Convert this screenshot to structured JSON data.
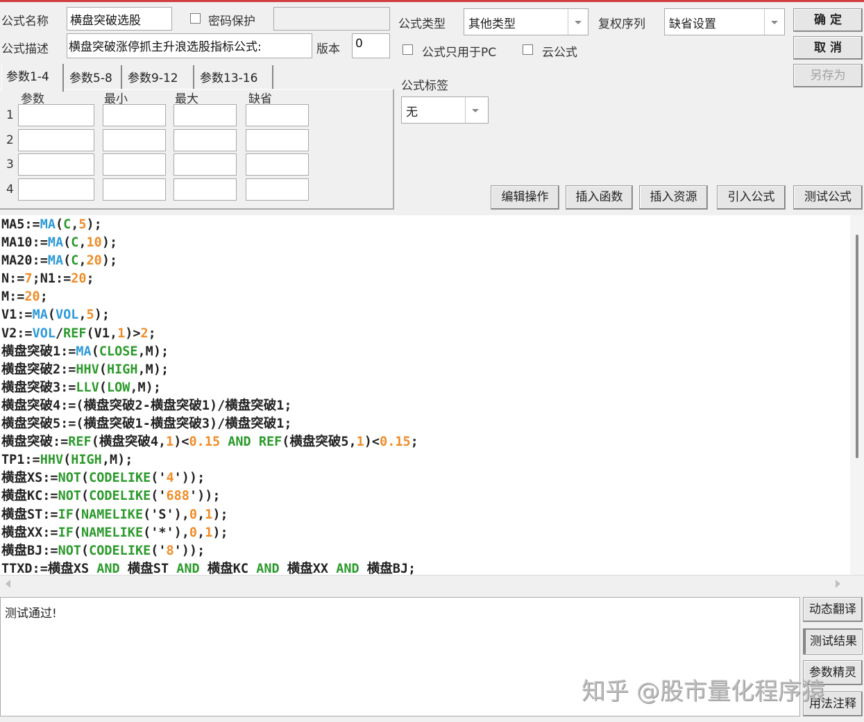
{
  "form": {
    "name_label": "公式名称",
    "name_value": "横盘突破选股",
    "password_label": "密码保护",
    "password_value": "",
    "desc_label": "公式描述",
    "desc_value": "横盘突破涨停抓主升浪选股指标公式:",
    "version_label": "版本",
    "version_value": "0",
    "type_label": "公式类型",
    "type_value": "其他类型",
    "rights_label": "复权序列",
    "rights_value": "缺省设置",
    "pc_only_label": "公式只用于PC",
    "cloud_label": "云公式",
    "tag_label": "公式标签",
    "tag_value": "无"
  },
  "actions": {
    "ok": "确  定",
    "cancel": "取  消",
    "save_as": "另存为"
  },
  "tabs": [
    "参数1-4",
    "参数5-8",
    "参数9-12",
    "参数13-16"
  ],
  "params": {
    "headers": [
      "参数",
      "最小",
      "最大",
      "缺省"
    ],
    "rows": [
      "1",
      "2",
      "3",
      "4"
    ]
  },
  "toolbar": [
    "编辑操作",
    "插入函数",
    "插入资源",
    "引入公式",
    "测试公式"
  ],
  "code": [
    [
      [
        "p",
        "MA5:="
      ],
      [
        "b",
        "MA"
      ],
      [
        "p",
        "("
      ],
      [
        "g",
        "C"
      ],
      [
        "p",
        ","
      ],
      [
        "o",
        "5"
      ],
      [
        "p",
        ");"
      ]
    ],
    [
      [
        "p",
        "MA10:="
      ],
      [
        "b",
        "MA"
      ],
      [
        "p",
        "("
      ],
      [
        "g",
        "C"
      ],
      [
        "p",
        ","
      ],
      [
        "o",
        "10"
      ],
      [
        "p",
        ");"
      ]
    ],
    [
      [
        "p",
        "MA20:="
      ],
      [
        "b",
        "MA"
      ],
      [
        "p",
        "("
      ],
      [
        "g",
        "C"
      ],
      [
        "p",
        ","
      ],
      [
        "o",
        "20"
      ],
      [
        "p",
        ");"
      ]
    ],
    [
      [
        "p",
        "N:="
      ],
      [
        "o",
        "7"
      ],
      [
        "p",
        ";N1:="
      ],
      [
        "o",
        "20"
      ],
      [
        "p",
        ";"
      ]
    ],
    [
      [
        "p",
        "M:="
      ],
      [
        "o",
        "20"
      ],
      [
        "p",
        ";"
      ]
    ],
    [
      [
        "p",
        "V1:="
      ],
      [
        "b",
        "MA"
      ],
      [
        "p",
        "("
      ],
      [
        "b",
        "VOL"
      ],
      [
        "p",
        ","
      ],
      [
        "o",
        "5"
      ],
      [
        "p",
        ");"
      ]
    ],
    [
      [
        "p",
        "V2:="
      ],
      [
        "b",
        "VOL"
      ],
      [
        "p",
        "/"
      ],
      [
        "g",
        "REF"
      ],
      [
        "p",
        "(V1,"
      ],
      [
        "o",
        "1"
      ],
      [
        "p",
        ")>"
      ],
      [
        "o",
        "2"
      ],
      [
        "p",
        ";"
      ]
    ],
    [
      [
        "p",
        "横盘突破1:="
      ],
      [
        "b",
        "MA"
      ],
      [
        "p",
        "("
      ],
      [
        "g",
        "CLOSE"
      ],
      [
        "p",
        ",M);"
      ]
    ],
    [
      [
        "p",
        "横盘突破2:="
      ],
      [
        "g",
        "HHV"
      ],
      [
        "p",
        "("
      ],
      [
        "g",
        "HIGH"
      ],
      [
        "p",
        ",M);"
      ]
    ],
    [
      [
        "p",
        "横盘突破3:="
      ],
      [
        "g",
        "LLV"
      ],
      [
        "p",
        "("
      ],
      [
        "g",
        "LOW"
      ],
      [
        "p",
        ",M);"
      ]
    ],
    [
      [
        "p",
        "横盘突破4:=(横盘突破2-横盘突破1)/横盘突破1;"
      ]
    ],
    [
      [
        "p",
        "横盘突破5:=(横盘突破1-横盘突破3)/横盘突破1;"
      ]
    ],
    [
      [
        "p",
        "横盘突破:="
      ],
      [
        "g",
        "REF"
      ],
      [
        "p",
        "(横盘突破4,"
      ],
      [
        "o",
        "1"
      ],
      [
        "p",
        ")<"
      ],
      [
        "o",
        "0.15"
      ],
      [
        "p",
        " "
      ],
      [
        "g",
        "AND"
      ],
      [
        "p",
        " "
      ],
      [
        "g",
        "REF"
      ],
      [
        "p",
        "(横盘突破5,"
      ],
      [
        "o",
        "1"
      ],
      [
        "p",
        ")<"
      ],
      [
        "o",
        "0.15"
      ],
      [
        "p",
        ";"
      ]
    ],
    [
      [
        "p",
        "TP1:="
      ],
      [
        "g",
        "HHV"
      ],
      [
        "p",
        "("
      ],
      [
        "g",
        "HIGH"
      ],
      [
        "p",
        ",M);"
      ]
    ],
    [
      [
        "p",
        "横盘XS:="
      ],
      [
        "g",
        "NOT"
      ],
      [
        "p",
        "("
      ],
      [
        "g",
        "CODELIKE"
      ],
      [
        "p",
        "('"
      ],
      [
        "o",
        "4"
      ],
      [
        "p",
        "'));"
      ]
    ],
    [
      [
        "p",
        "横盘KC:="
      ],
      [
        "g",
        "NOT"
      ],
      [
        "p",
        "("
      ],
      [
        "g",
        "CODELIKE"
      ],
      [
        "p",
        "('"
      ],
      [
        "o",
        "688"
      ],
      [
        "p",
        "'));"
      ]
    ],
    [
      [
        "p",
        "横盘ST:="
      ],
      [
        "g",
        "IF"
      ],
      [
        "p",
        "("
      ],
      [
        "g",
        "NAMELIKE"
      ],
      [
        "p",
        "('S'),"
      ],
      [
        "o",
        "0"
      ],
      [
        "p",
        ","
      ],
      [
        "o",
        "1"
      ],
      [
        "p",
        ");"
      ]
    ],
    [
      [
        "p",
        "横盘XX:="
      ],
      [
        "g",
        "IF"
      ],
      [
        "p",
        "("
      ],
      [
        "g",
        "NAMELIKE"
      ],
      [
        "p",
        "('*'),"
      ],
      [
        "o",
        "0"
      ],
      [
        "p",
        ","
      ],
      [
        "o",
        "1"
      ],
      [
        "p",
        ");"
      ]
    ],
    [
      [
        "p",
        "横盘BJ:="
      ],
      [
        "g",
        "NOT"
      ],
      [
        "p",
        "("
      ],
      [
        "g",
        "CODELIKE"
      ],
      [
        "p",
        "('"
      ],
      [
        "o",
        "8"
      ],
      [
        "p",
        "'));"
      ]
    ],
    [
      [
        "p",
        "TTXD:=横盘XS "
      ],
      [
        "g",
        "AND"
      ],
      [
        "p",
        " 横盘ST "
      ],
      [
        "g",
        "AND"
      ],
      [
        "p",
        " 横盘KC "
      ],
      [
        "g",
        "AND"
      ],
      [
        "p",
        " 横盘XX "
      ],
      [
        "g",
        "AND"
      ],
      [
        "p",
        " 横盘BJ;"
      ]
    ]
  ],
  "output": {
    "message": "测试通过!"
  },
  "side_buttons": [
    "动态翻译",
    "测试结果",
    "参数精灵",
    "用法注释"
  ],
  "watermark": "知乎 @股市量化程序猿",
  "colors": {
    "function_blue": "#2e9ad8",
    "keyword_green": "#2c9a2c",
    "number_orange": "#f08c28"
  }
}
